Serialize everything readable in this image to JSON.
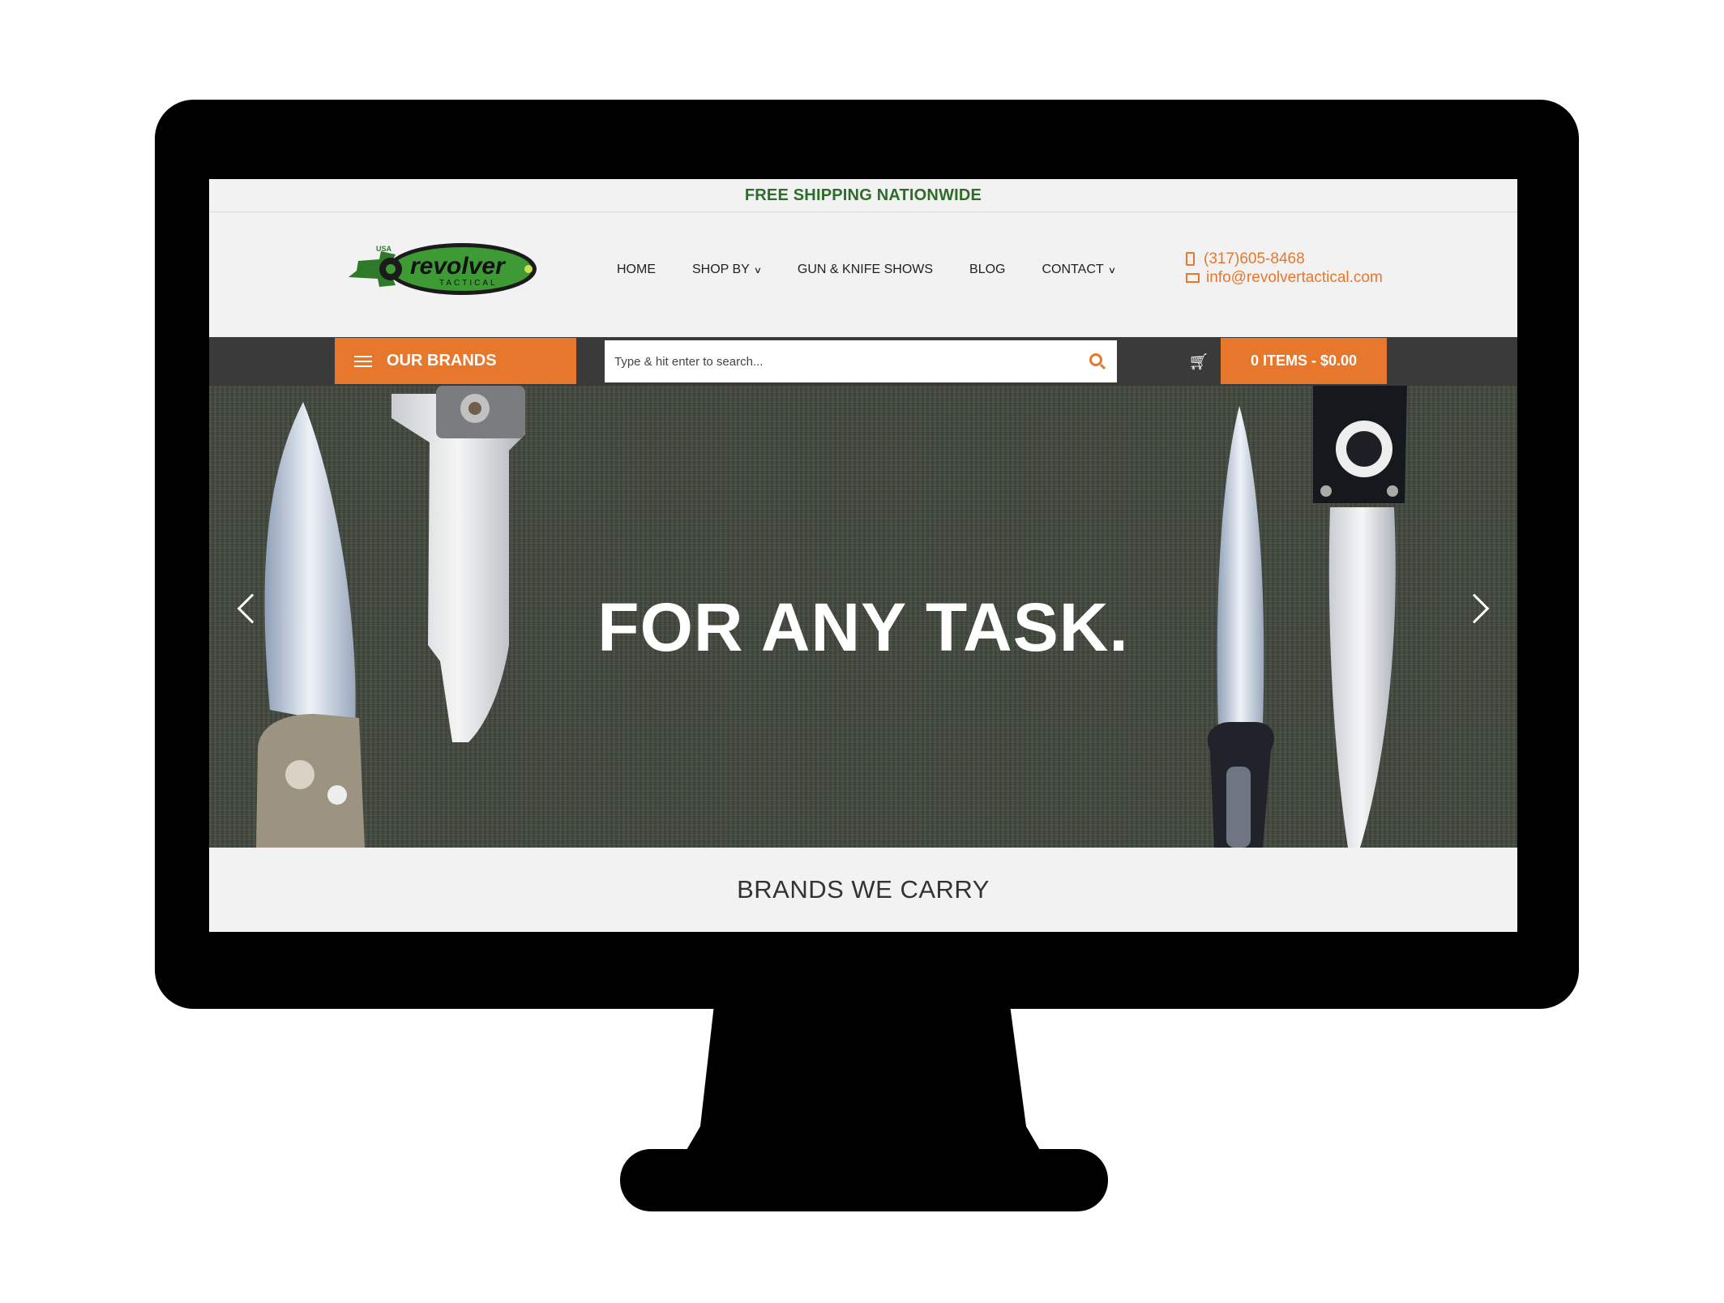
{
  "announcement": "FREE SHIPPING NATIONWIDE",
  "logo": {
    "text": "revolver",
    "subtext": "TACTICAL",
    "badge": "USA"
  },
  "nav": [
    {
      "label": "HOME",
      "dropdown": false
    },
    {
      "label": "SHOP BY",
      "dropdown": true
    },
    {
      "label": "GUN & KNIFE SHOWS",
      "dropdown": false
    },
    {
      "label": "BLOG",
      "dropdown": false
    },
    {
      "label": "CONTACT",
      "dropdown": true
    }
  ],
  "contact": {
    "phone": "(317)605-8468",
    "email": "info@revolvertactical.com"
  },
  "toolbar": {
    "brands_label": "OUR BRANDS",
    "search_placeholder": "Type & hit enter to search...",
    "cart_label": "0 ITEMS - $0.00"
  },
  "hero": {
    "title": "FOR ANY TASK."
  },
  "brands_section": {
    "title": "BRANDS WE CARRY"
  },
  "colors": {
    "accent": "#e8772e",
    "green": "#2f6b2a",
    "toolbar": "#3a3a3a"
  }
}
